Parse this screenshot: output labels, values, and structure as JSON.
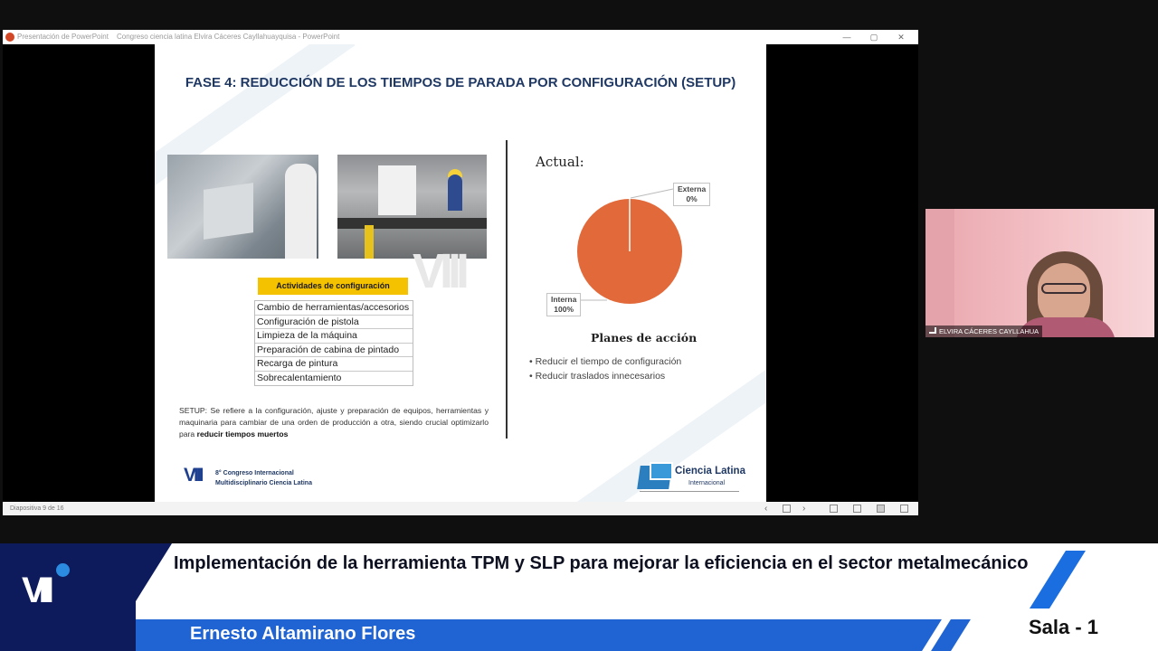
{
  "ppt_window": {
    "title_app": "Presentación de PowerPoint",
    "title_doc": "Congreso ciencia latina Elvira Cáceres Cayllahuayquisa - PowerPoint",
    "controls": [
      "—",
      "▢",
      "✕"
    ],
    "status_slide": "Diapositiva 9 de 16"
  },
  "slide": {
    "title": "FASE 4: REDUCCIÓN DE LOS TIEMPOS DE PARADA POR CONFIGURACIÓN (SETUP)",
    "watermark": "VIII",
    "activities_header": "Actividades de configuración",
    "activities": [
      "Cambio de herramientas/accesorios",
      "Configuración de pistola",
      "Limpieza de la máquina",
      "Preparación de cabina de pintado",
      "Recarga de pintura",
      "Sobrecalentamiento"
    ],
    "setup_text_main": "SETUP: Se refiere a la configuración, ajuste y preparación de equipos, herramientas y maquinaria para cambiar de una orden de producción a otra, siendo crucial optimizarlo para ",
    "setup_text_bold": "reducir tiempos muertos",
    "actual_label": "Actual:",
    "pie": {
      "externa_label": "Externa",
      "externa_value": "0%",
      "interna_label": "Interna",
      "interna_value": "100%",
      "color_interna": "#e2693a"
    },
    "plans_title": "Planes de acción",
    "plans": [
      "Reducir el tiempo de configuración",
      "Reducir traslados innecesarios"
    ],
    "congress_logo": "VIII",
    "congress_line1": "8° Congreso Internacional",
    "congress_line2": "Multidisciplinario Ciencia Latina",
    "cl_name": "Ciencia Latina",
    "cl_sub": "Internacional"
  },
  "webcam": {
    "participant_name": "ELVIRA CÁCERES CAYLLAHUA"
  },
  "banner": {
    "logo": "VIII",
    "title": "Implementación de la herramienta TPM y SLP para mejorar la eficiencia en el sector metalmecánico",
    "speaker": "Ernesto Altamirano Flores",
    "room": "Sala - 1"
  }
}
